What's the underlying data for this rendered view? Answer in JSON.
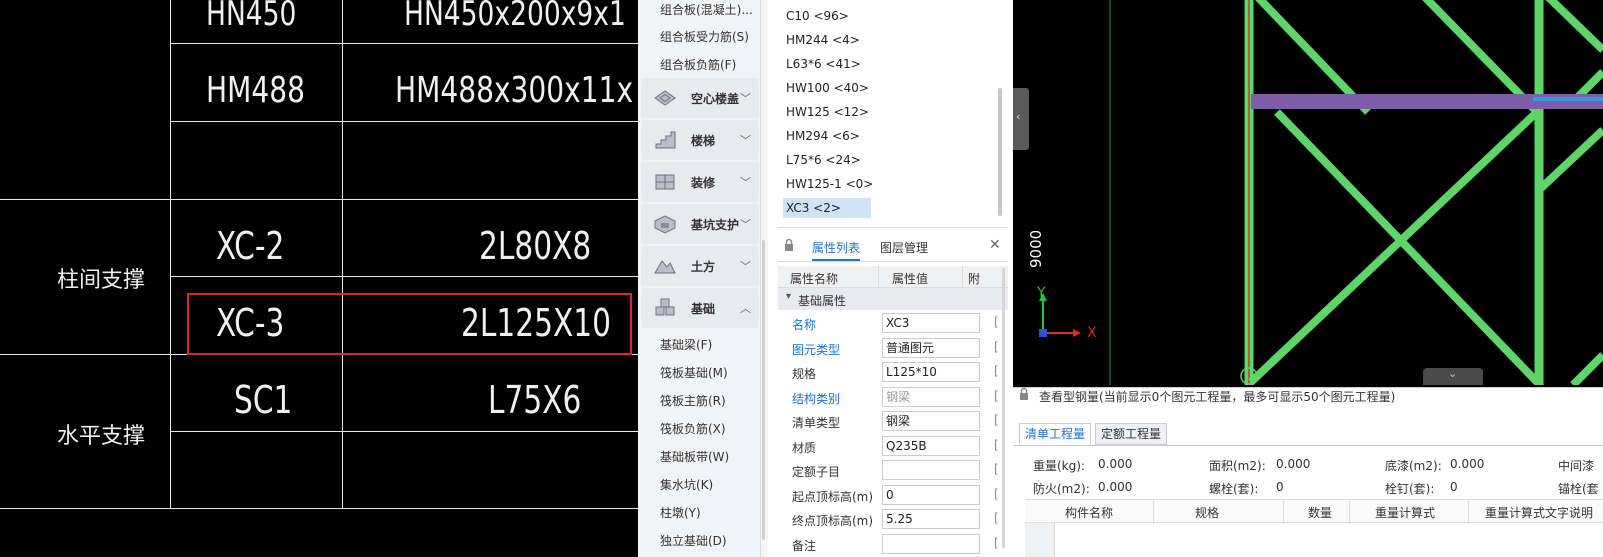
{
  "cad_table": {
    "rows": [
      {
        "code": "HN450",
        "spec": "HN450x200x9x1"
      },
      {
        "code": "HM488",
        "spec": "HM488x300x11x"
      },
      {
        "code": "XC-2",
        "spec": "2L80X8"
      },
      {
        "code": "XC-3",
        "spec": "2L125X10"
      },
      {
        "code": "SC1",
        "spec": "L75X6"
      }
    ],
    "group_col_support": "柱间支撑",
    "group_horiz_support": "水平支撑",
    "highlight_color": "#e0261f"
  },
  "nav": {
    "top_items": [
      "组合板(混凝土)...",
      "组合板受力筋(S)",
      "组合板负筋(F)"
    ],
    "categories": [
      {
        "label": "空心楼盖",
        "icon": "hollow-floor-icon",
        "expanded": false
      },
      {
        "label": "楼梯",
        "icon": "stairs-icon",
        "expanded": false
      },
      {
        "label": "装修",
        "icon": "decoration-icon",
        "expanded": false
      },
      {
        "label": "基坑支护",
        "icon": "pit-support-icon",
        "expanded": false
      },
      {
        "label": "土方",
        "icon": "earthwork-icon",
        "expanded": false
      },
      {
        "label": "基础",
        "icon": "foundation-icon",
        "expanded": true
      }
    ],
    "foundation_items": [
      "基础梁(F)",
      "筏板基础(M)",
      "筏板主筋(R)",
      "筏板负筋(X)",
      "基础板带(W)",
      "集水坑(K)",
      "柱墩(Y)",
      "独立基础(D)"
    ]
  },
  "component_list": {
    "items": [
      "C10 <96>",
      "HM244 <4>",
      "L63*6 <41>",
      "HW100 <40>",
      "HW125 <12>",
      "HM294 <6>",
      "L75*6 <24>",
      "HW125-1 <0>",
      "XC3 <2>"
    ],
    "selected_index": 8
  },
  "props": {
    "tab_active": "属性列表",
    "tab_other": "图层管理",
    "col_name": "属性名称",
    "col_value": "属性值",
    "col_extra": "附",
    "section": "基础属性",
    "rows": [
      {
        "name": "名称",
        "value": "XC3",
        "blue": true,
        "gray": false
      },
      {
        "name": "图元类型",
        "value": "普通图元",
        "blue": true,
        "gray": false
      },
      {
        "name": "规格",
        "value": "L125*10",
        "blue": false,
        "gray": false
      },
      {
        "name": "结构类别",
        "value": "钢梁",
        "blue": true,
        "gray": true
      },
      {
        "name": "清单类型",
        "value": "钢梁",
        "blue": false,
        "gray": false
      },
      {
        "name": "材质",
        "value": "Q235B",
        "blue": false,
        "gray": false
      },
      {
        "name": "定额子目",
        "value": "",
        "blue": false,
        "gray": false
      },
      {
        "name": "起点顶标高(m)",
        "value": "0",
        "blue": false,
        "gray": false
      },
      {
        "name": "终点顶标高(m)",
        "value": "5.25",
        "blue": false,
        "gray": false
      },
      {
        "name": "备注",
        "value": "",
        "blue": false,
        "gray": false
      }
    ]
  },
  "viewport": {
    "dimension_label": "9000",
    "axis_y": "Y",
    "axis_x": "X",
    "member_color": "#5fd46a",
    "beam_color": "#7b5ea7"
  },
  "quantities": {
    "title": "查看型钢量(当前显示0个图元工程量，最多可显示50个图元工程量)",
    "tab_active": "清单工程量",
    "tab_other": "定额工程量",
    "row1": [
      {
        "label": "重量(kg):",
        "value": "0.000"
      },
      {
        "label": "面积(m2):",
        "value": "0.000"
      },
      {
        "label": "底漆(m2):",
        "value": "0.000"
      },
      {
        "label": "中间漆",
        "value": ""
      }
    ],
    "row2": [
      {
        "label": "防火(m2):",
        "value": "0.000"
      },
      {
        "label": "螺栓(套):",
        "value": "0"
      },
      {
        "label": "栓钉(套):",
        "value": "0"
      },
      {
        "label": "锚栓(套",
        "value": ""
      }
    ],
    "columns": [
      "构件名称",
      "规格",
      "数量",
      "重量计算式",
      "重量计算式文字说明"
    ]
  }
}
